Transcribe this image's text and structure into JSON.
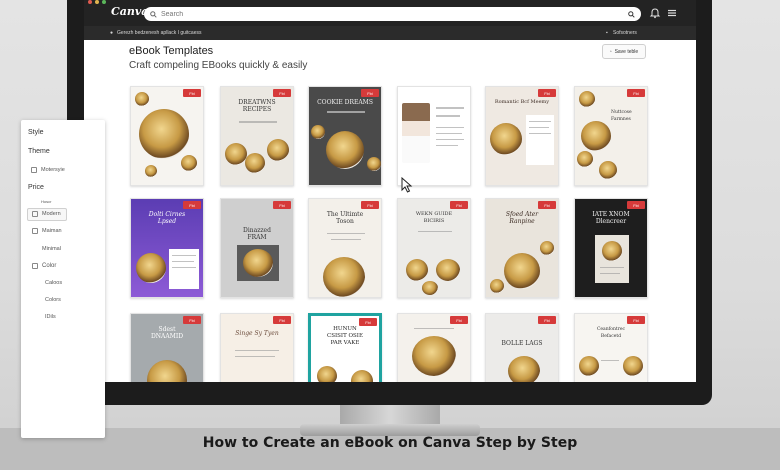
{
  "app": {
    "logo": "Canva",
    "search_placeholder": "Search",
    "notice": "Gerezh bedzenesh apllack I guitcaess",
    "right_label": "Sofsotners"
  },
  "header": {
    "title": "eBook Templates",
    "subtitle": "Craft compeling EBooks quickly & easily",
    "save_button": "Save teble"
  },
  "badge_label": "Fbi",
  "templates": [
    {
      "title": ""
    },
    {
      "title": "DREATWNS\nRECIPES"
    },
    {
      "title": "COOKIE DREAMS"
    },
    {
      "title": ""
    },
    {
      "title": "Romantic Bcf Meemy"
    },
    {
      "title": "Nuttcose\nFarmnes"
    },
    {
      "title": "Dolti Cirnes\nLpsed"
    },
    {
      "title": "Dinazzed\nFRAM"
    },
    {
      "title": "The Ultimte\nToson"
    },
    {
      "title": "WEKN GUIDE\nBICIRIS"
    },
    {
      "title": "Sfoed Ater\nRanpine"
    },
    {
      "title": "IATE XNOM\nDlencreer"
    },
    {
      "title": "Sdest\nDNAAMID"
    },
    {
      "title": "Singe Sy Tyen"
    },
    {
      "title": "HUNUN\nCSISIT OSIE\nPAR VAKE"
    },
    {
      "title": ""
    },
    {
      "title": "BOLLE LAGS"
    },
    {
      "title": "Ceanfontrec\nBefacetd"
    }
  ],
  "sidebar": {
    "style": "Style",
    "theme": "Theme",
    "theme_option": "Motersyie",
    "price": "Price",
    "price_small": "Hoscr",
    "price_option_1": "Modern",
    "price_option_2": "Maiman",
    "price_option_3": "Minimal",
    "color": "Color",
    "color_option_1": "Caloos",
    "color_option_2": "Colors",
    "color_option_3": "IDils"
  },
  "caption": "How to Create an eBook on Canva Step by Step",
  "colors": {
    "topbar": "#232323",
    "badge": "#d63a3a",
    "background": "#e0e0e0"
  }
}
